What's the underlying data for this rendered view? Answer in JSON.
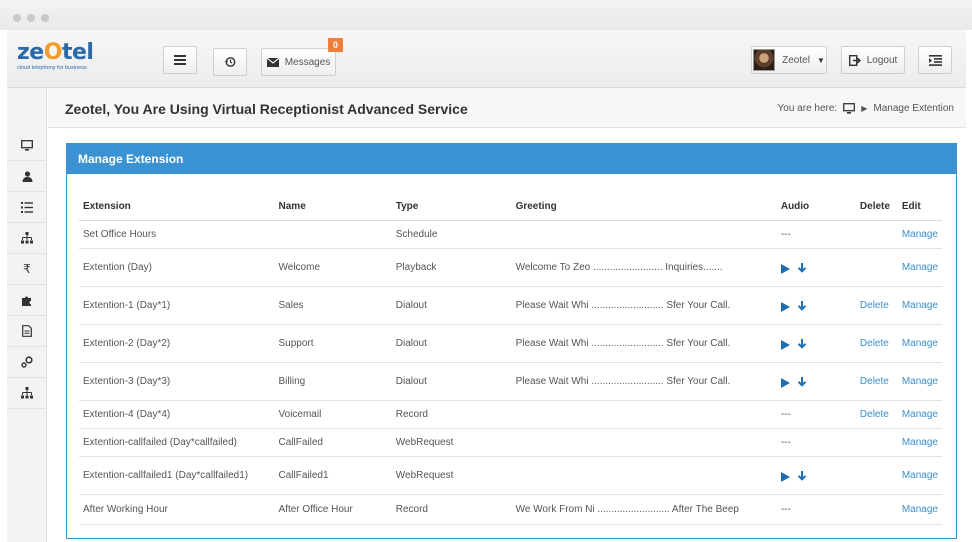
{
  "brand": {
    "logo_text": "ze tel",
    "tagline": "cloud telephony for business",
    "accent": "#3b92d2",
    "badge_color": "#f07d3a"
  },
  "toolbar": {
    "messages_label": "Messages",
    "messages_count": "0",
    "user_name": "Zeotel",
    "logout_label": "Logout"
  },
  "header": {
    "title": "Zeotel, You Are Using Virtual Receptionist Advanced Service",
    "breadcrumb_prefix": "You are here:",
    "breadcrumb_current": "Manage Extention"
  },
  "sidebar_icons": [
    "monitor-icon",
    "user-icon",
    "list-icon",
    "sitemap-icon",
    "rupee-icon",
    "puzzle-icon",
    "document-icon",
    "settings-icon",
    "hierarchy-icon"
  ],
  "panel": {
    "title": "Manage Extension",
    "columns": [
      "Extension",
      "Name",
      "Type",
      "Greeting",
      "Audio",
      "Delete",
      "Edit"
    ],
    "rows": [
      {
        "extension": "Set Office Hours",
        "name": "",
        "type": "Schedule",
        "greeting": "",
        "audio": "---",
        "delete": "",
        "edit": "Manage"
      },
      {
        "extension": "Extention (Day)",
        "name": "Welcome",
        "type": "Playback",
        "greeting": "Welcome To Zeo ......................... Inquiries.......",
        "audio": "icons",
        "delete": "",
        "edit": "Manage"
      },
      {
        "extension": "Extention-1 (Day*1)",
        "name": "Sales",
        "type": "Dialout",
        "greeting": "Please Wait Whi .......................... Sfer Your Call.",
        "audio": "icons",
        "delete": "Delete",
        "edit": "Manage"
      },
      {
        "extension": "Extention-2 (Day*2)",
        "name": "Support",
        "type": "Dialout",
        "greeting": "Please Wait Whi .......................... Sfer Your Call.",
        "audio": "icons",
        "delete": "Delete",
        "edit": "Manage"
      },
      {
        "extension": "Extention-3 (Day*3)",
        "name": "Billing",
        "type": "Dialout",
        "greeting": "Please Wait Whi .......................... Sfer Your Call.",
        "audio": "icons",
        "delete": "Delete",
        "edit": "Manage"
      },
      {
        "extension": "Extention-4 (Day*4)",
        "name": "Voicemail",
        "type": "Record",
        "greeting": "",
        "audio": "---",
        "delete": "Delete",
        "edit": "Manage"
      },
      {
        "extension": "Extention-callfailed (Day*callfailed)",
        "name": "CallFailed",
        "type": "WebRequest",
        "greeting": "",
        "audio": "---",
        "delete": "",
        "edit": "Manage"
      },
      {
        "extension": "Extention-callfailed1 (Day*callfailed1)",
        "name": "CallFailed1",
        "type": "WebRequest",
        "greeting": "",
        "audio": "icons",
        "delete": "",
        "edit": "Manage"
      },
      {
        "extension": "After Working Hour",
        "name": "After Office Hour",
        "type": "Record",
        "greeting": "We Work From Ni .......................... After The Beep",
        "audio": "---",
        "delete": "",
        "edit": "Manage"
      }
    ]
  }
}
